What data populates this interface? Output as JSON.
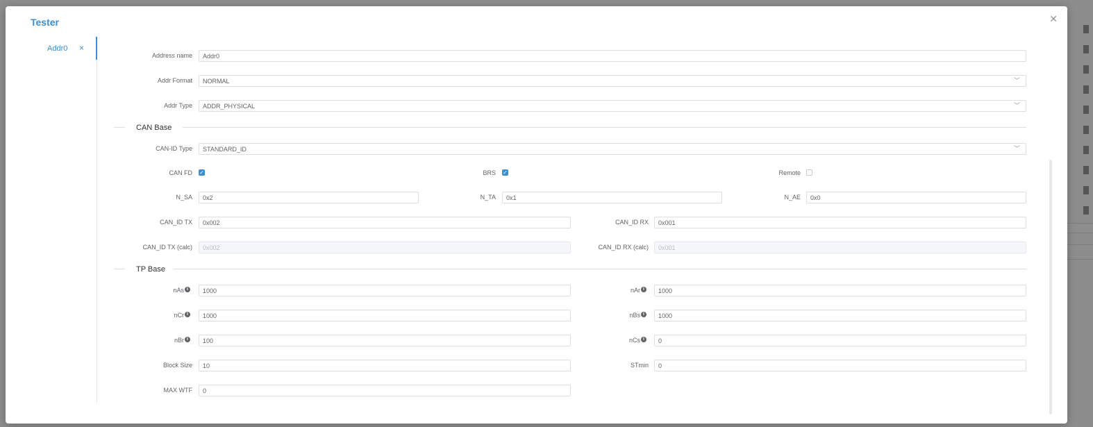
{
  "dialog": {
    "title": "Tester"
  },
  "tabs": [
    {
      "label": "Addr0"
    }
  ],
  "form": {
    "address_name": {
      "label": "Address name",
      "value": "Addr0"
    },
    "addr_format": {
      "label": "Addr Format",
      "value": "NORMAL"
    },
    "addr_type": {
      "label": "Addr Type",
      "value": "ADDR_PHYSICAL"
    }
  },
  "can_base": {
    "title": "CAN Base",
    "can_id_type": {
      "label": "CAN-ID Type",
      "value": "STANDARD_ID"
    },
    "can_fd": {
      "label": "CAN FD",
      "checked": true
    },
    "brs": {
      "label": "BRS",
      "checked": true
    },
    "remote": {
      "label": "Remote",
      "checked": false
    },
    "n_sa": {
      "label": "N_SA",
      "value": "0x2"
    },
    "n_ta": {
      "label": "N_TA",
      "value": "0x1"
    },
    "n_ae": {
      "label": "N_AE",
      "value": "0x0"
    },
    "can_id_tx": {
      "label": "CAN_ID TX",
      "value": "0x002"
    },
    "can_id_rx": {
      "label": "CAN_ID RX",
      "value": "0x001"
    },
    "can_id_tx_calc": {
      "label": "CAN_ID TX (calc)",
      "value": "0x002"
    },
    "can_id_rx_calc": {
      "label": "CAN_ID RX (calc)",
      "value": "0x001"
    }
  },
  "tp_base": {
    "title": "TP Base",
    "nas": {
      "label": "nAs",
      "value": "1000"
    },
    "nar": {
      "label": "nAr",
      "value": "1000"
    },
    "ncr": {
      "label": "nCr",
      "value": "1000"
    },
    "nbs": {
      "label": "nBs",
      "value": "1000"
    },
    "nbr": {
      "label": "nBr",
      "value": "100"
    },
    "ncs": {
      "label": "nCs",
      "value": "0"
    },
    "block_size": {
      "label": "Block Size",
      "value": "10"
    },
    "stmin": {
      "label": "STmin",
      "value": "0"
    },
    "max_wtf": {
      "label": "MAX WTF",
      "value": "0"
    }
  },
  "colors": {
    "accent": "#3e8ed0",
    "backdrop": "#8d8d8d"
  }
}
